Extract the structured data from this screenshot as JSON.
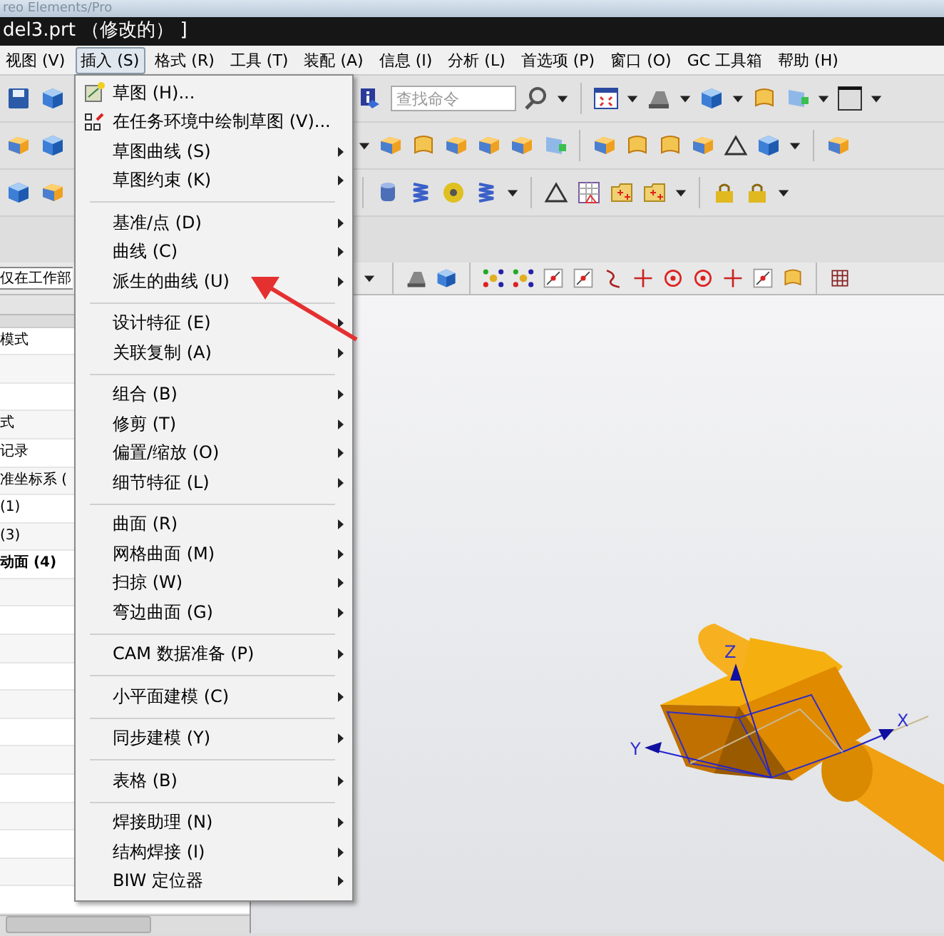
{
  "app_title": "reo Elements/Pro",
  "window": {
    "title": "del3.prt （修改的） ]"
  },
  "menu_bar": [
    {
      "label": "视图 (V)",
      "selected": false
    },
    {
      "label": "插入 (S)",
      "selected": true
    },
    {
      "label": "格式 (R)",
      "selected": false
    },
    {
      "label": "工具 (T)",
      "selected": false
    },
    {
      "label": "装配 (A)",
      "selected": false
    },
    {
      "label": "信息 (I)",
      "selected": false
    },
    {
      "label": "分析 (L)",
      "selected": false
    },
    {
      "label": "首选项 (P)",
      "selected": false
    },
    {
      "label": "窗口 (O)",
      "selected": false
    },
    {
      "label": "GC 工具箱",
      "selected": false
    },
    {
      "label": "帮助 (H)",
      "selected": false
    }
  ],
  "toolbar": {
    "search": {
      "placeholder": "查找命令"
    }
  },
  "selection_bar": {
    "filter": {
      "value": "仅在工作部"
    }
  },
  "insert_menu": {
    "groups": [
      [
        {
          "label": "草图 (H)...",
          "submenu": false,
          "kind": "sketch"
        },
        {
          "label": "在任务环境中绘制草图 (V)...",
          "submenu": false,
          "kind": "task-sketch"
        },
        {
          "label": "草图曲线 (S)",
          "submenu": true,
          "kind": "plain"
        },
        {
          "label": "草图约束 (K)",
          "submenu": true,
          "kind": "plain"
        }
      ],
      [
        {
          "label": "基准/点 (D)",
          "submenu": true,
          "kind": "plain"
        },
        {
          "label": "曲线 (C)",
          "submenu": true,
          "kind": "plain"
        },
        {
          "label": "派生的曲线 (U)",
          "submenu": true,
          "kind": "plain"
        }
      ],
      [
        {
          "label": "设计特征 (E)",
          "submenu": true,
          "kind": "plain"
        },
        {
          "label": "关联复制 (A)",
          "submenu": true,
          "kind": "plain"
        }
      ],
      [
        {
          "label": "组合 (B)",
          "submenu": true,
          "kind": "plain"
        },
        {
          "label": "修剪 (T)",
          "submenu": true,
          "kind": "plain"
        },
        {
          "label": "偏置/缩放 (O)",
          "submenu": true,
          "kind": "plain"
        },
        {
          "label": "细节特征 (L)",
          "submenu": true,
          "kind": "plain"
        }
      ],
      [
        {
          "label": "曲面 (R)",
          "submenu": true,
          "kind": "plain"
        },
        {
          "label": "网格曲面 (M)",
          "submenu": true,
          "kind": "plain"
        },
        {
          "label": "扫掠 (W)",
          "submenu": true,
          "kind": "plain"
        },
        {
          "label": "弯边曲面 (G)",
          "submenu": true,
          "kind": "plain"
        }
      ],
      [
        {
          "label": "CAM 数据准备 (P)",
          "submenu": true,
          "kind": "plain"
        }
      ],
      [
        {
          "label": "小平面建模 (C)",
          "submenu": true,
          "kind": "plain"
        }
      ],
      [
        {
          "label": "同步建模 (Y)",
          "submenu": true,
          "kind": "plain"
        }
      ],
      [
        {
          "label": "表格 (B)",
          "submenu": true,
          "kind": "plain"
        }
      ],
      [
        {
          "label": "焊接助理 (N)",
          "submenu": true,
          "kind": "plain"
        },
        {
          "label": "结构焊接 (I)",
          "submenu": true,
          "kind": "plain"
        },
        {
          "label": "BIW 定位器",
          "submenu": true,
          "kind": "plain"
        }
      ]
    ]
  },
  "navigator": {
    "rows": [
      {
        "kind": "text",
        "text": "模式",
        "bold": false
      },
      {
        "kind": "empty"
      },
      {
        "kind": "empty"
      },
      {
        "kind": "text",
        "text": "式",
        "bold": false
      },
      {
        "kind": "text",
        "text": "记录",
        "bold": false
      },
      {
        "kind": "text",
        "text": "准坐标系 (",
        "bold": false
      },
      {
        "kind": "text",
        "text": "(1)",
        "bold": false
      },
      {
        "kind": "text",
        "text": "(3)",
        "bold": false
      },
      {
        "kind": "text",
        "text": "动面 (4)",
        "bold": true
      },
      {
        "kind": "empty"
      },
      {
        "kind": "empty"
      },
      {
        "kind": "empty"
      },
      {
        "kind": "empty"
      },
      {
        "kind": "empty"
      },
      {
        "kind": "empty"
      },
      {
        "kind": "empty"
      },
      {
        "kind": "empty"
      },
      {
        "kind": "empty"
      },
      {
        "kind": "empty"
      },
      {
        "kind": "empty"
      },
      {
        "kind": "empty"
      }
    ]
  },
  "viewport": {
    "axes": [
      {
        "label": "Z"
      },
      {
        "label": "X"
      },
      {
        "label": "Y"
      }
    ]
  }
}
